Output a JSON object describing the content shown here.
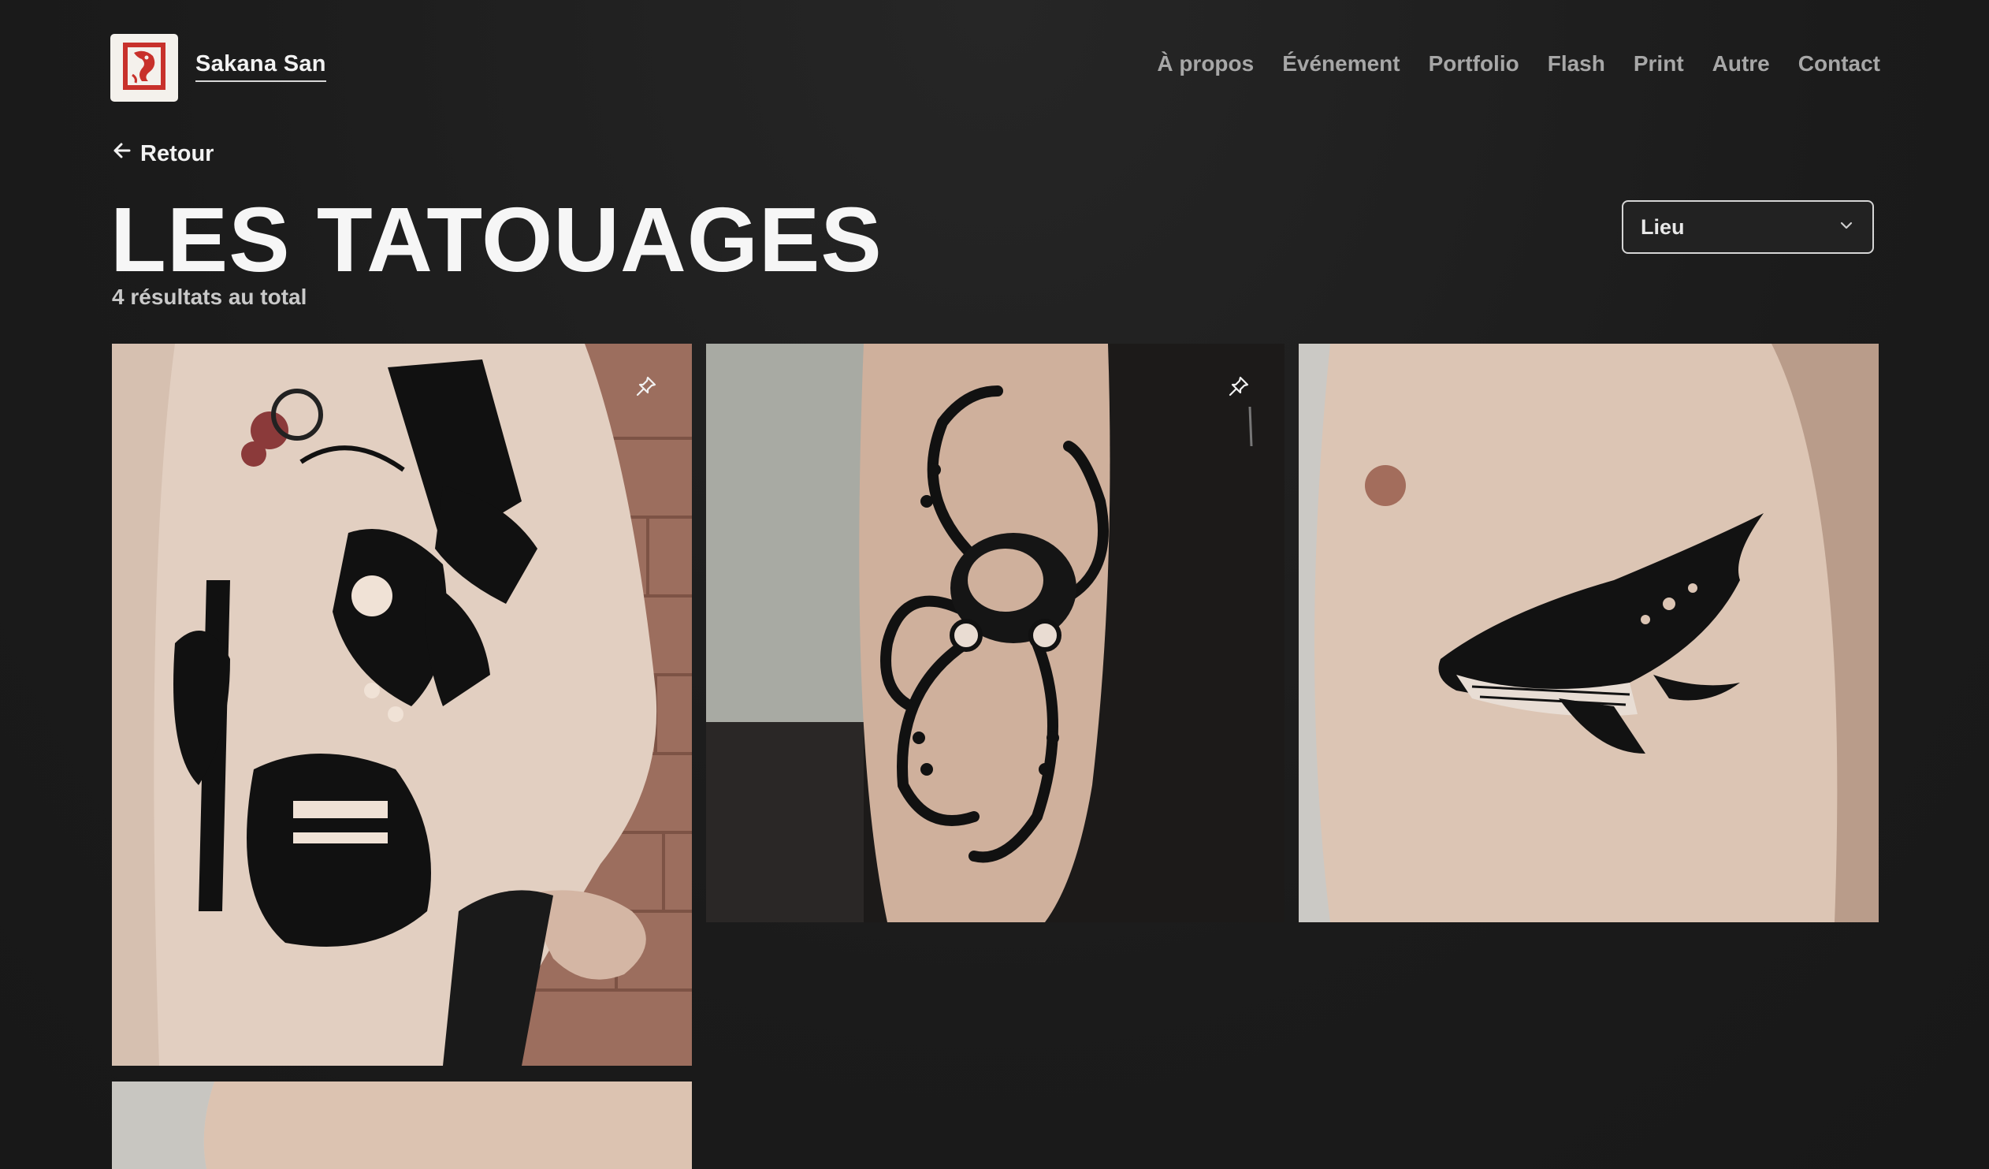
{
  "site": {
    "name": "Sakana San",
    "logo_icon": "koi-seal-icon",
    "accent_red": "#c8312b"
  },
  "nav": {
    "items": [
      {
        "label": "À propos"
      },
      {
        "label": "Événement"
      },
      {
        "label": "Portfolio"
      },
      {
        "label": "Flash"
      },
      {
        "label": "Print"
      },
      {
        "label": "Autre"
      },
      {
        "label": "Contact"
      }
    ]
  },
  "back": {
    "label": "Retour",
    "icon": "arrow-left-icon"
  },
  "page": {
    "title": "LES TATOUAGES",
    "result_count": "4 résultats au total"
  },
  "filter": {
    "selected": "Lieu",
    "icon": "chevron-down-icon"
  },
  "gallery": {
    "items": [
      {
        "subject": "samurai back piece",
        "pinned": true,
        "pin_icon": "pin-icon"
      },
      {
        "subject": "mechanical octopus on arm",
        "pinned": true,
        "pin_icon": "pin-icon"
      },
      {
        "subject": "humpback whale on ribs",
        "pinned": false
      },
      {
        "subject": "partial image",
        "pinned": false
      }
    ]
  }
}
